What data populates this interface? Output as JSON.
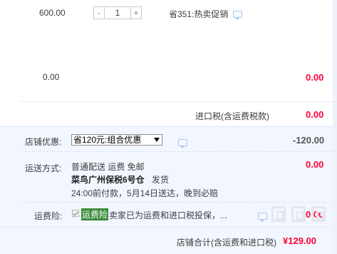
{
  "item": {
    "price": "600.00",
    "quantity": "1",
    "minus_label": "-",
    "plus_label": "+",
    "promotion": "省351:热卖促销"
  },
  "row2": {
    "price": "0.00",
    "total": "0.00"
  },
  "import_tax": {
    "label": "进口税(含运费税款)",
    "value": "0.00"
  },
  "shop_discount": {
    "label": "店铺优惠:",
    "selected": "省120元:组合优惠",
    "value": "-120.00"
  },
  "shipping": {
    "label": "运送方式:",
    "method": "普通配送  运费 免邮",
    "warehouse": "菜鸟广州保税6号仓",
    "ship_word": "发货",
    "schedule": "24:00前付款，5月14日送达，晚到必赔",
    "value": "0.00"
  },
  "insurance": {
    "label": "运费险:",
    "tag": "运费险",
    "desc": "卖家已为运费和进口税投保，...",
    "value": "0.00"
  },
  "footer": {
    "total_label": "店铺合计(含运费和进口税)",
    "total_value": "¥129.00"
  },
  "colors": {
    "price_red": "#ff0036",
    "section_bg": "#f2f7ff",
    "insurance_tag_bg": "#3a8b3a"
  },
  "icons": [
    "chat-icon",
    "dropdown-caret-icon",
    "checkbox-check-icon",
    "watermark-icon"
  ]
}
